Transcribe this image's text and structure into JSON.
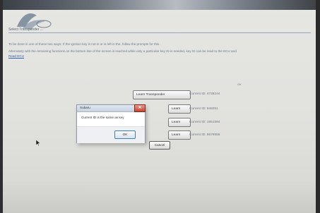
{
  "header": {
    "logo_alt": "logo",
    "subtab": "Select Transponder ..."
  },
  "content": {
    "para1": "To be done in one of these two ways: If the ignition key is not in or is left in the, follow the prompts for this.",
    "para2_a": "Alternately with the remaining functions on the bottom line of the screen is reached while only a particular key ID is needed, key ID can be read to the ECU and",
    "para2_link": "Read ECU",
    "mini_label": "OK"
  },
  "rows": [
    {
      "button": "Learn Transponder",
      "current_id": "Current ID: 4738244"
    },
    {
      "button": "Learn",
      "current_id": "Current ID: 946051"
    },
    {
      "button": "Learn",
      "current_id": "Current ID: 1951594"
    },
    {
      "button": "Learn",
      "current_id": "Current ID: 9679556"
    }
  ],
  "cancel_label": "Cancel",
  "dialog": {
    "title": "Subaru",
    "close_glyph": "✕",
    "message": "Current ID is the same as key",
    "ok_label": "OK"
  },
  "colors": {
    "accent_blue": "#3c7fb1",
    "close_red": "#c8412e"
  }
}
